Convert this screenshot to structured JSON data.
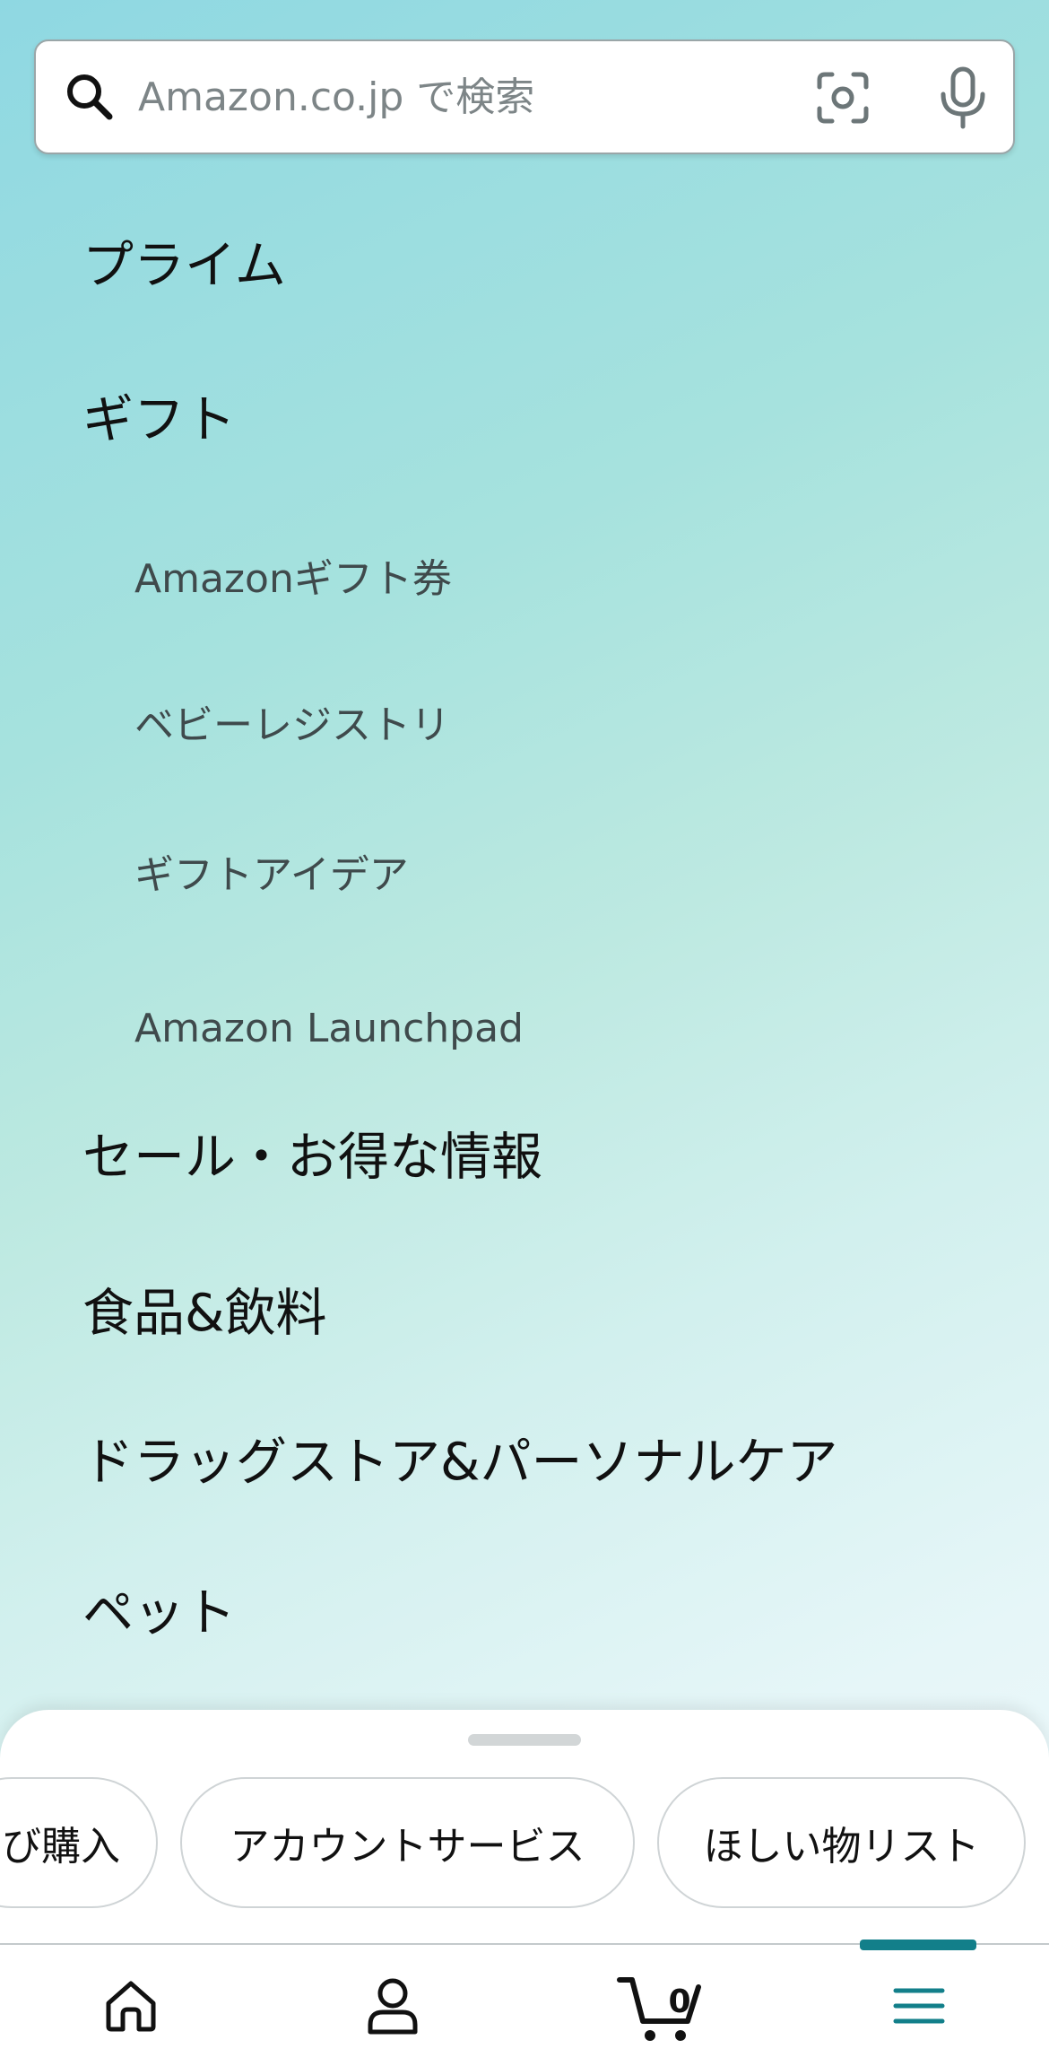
{
  "search": {
    "placeholder": "Amazon.co.jp で検索",
    "value": ""
  },
  "menu": {
    "prime": "プライム",
    "gift": "ギフト",
    "gift_items": [
      "Amazonギフト券",
      "ベビーレジストリ",
      "ギフトアイデア",
      "Amazon Launchpad"
    ],
    "sale": "セール・お得な情報",
    "food": "食品&飲料",
    "drugstore": "ドラッグストア&パーソナルケア",
    "pet": "ペット"
  },
  "bottom_sheet": {
    "chips": [
      "び購入",
      "アカウントサービス",
      "ほしい物リスト"
    ]
  },
  "bottom_nav": {
    "cart_count": "0",
    "active_tab": "menu",
    "accent_color": "#127f8a"
  }
}
